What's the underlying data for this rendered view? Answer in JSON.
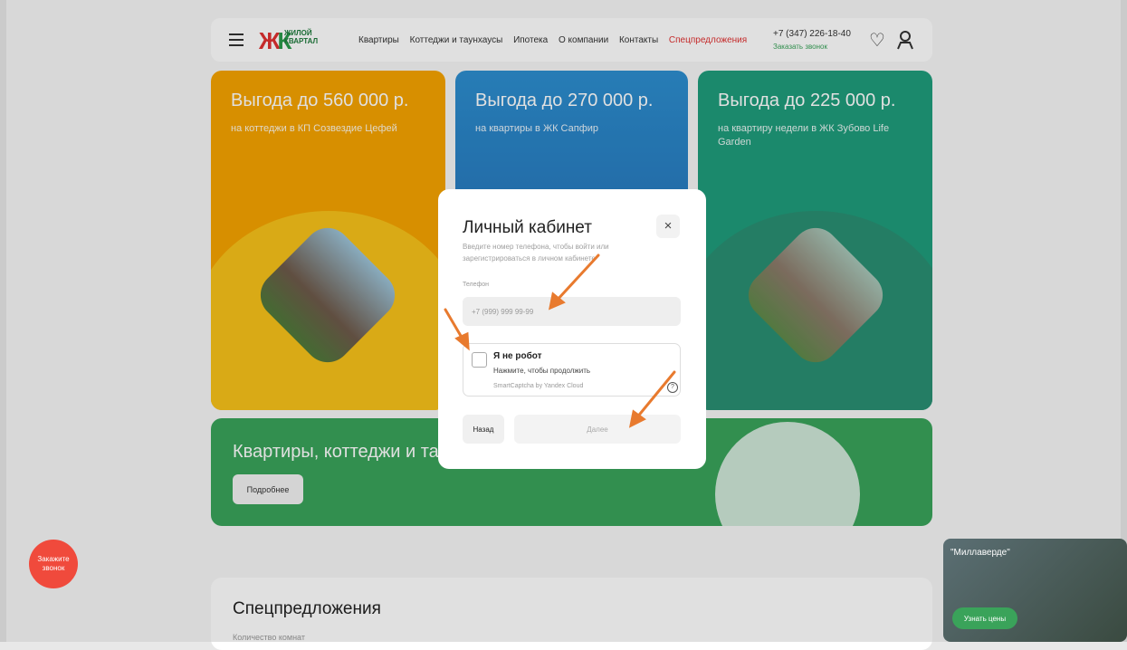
{
  "header": {
    "logo_title": "ЖИЛОЙ",
    "logo_subtitle": "КВАРТАЛ",
    "nav": [
      "Квартиры",
      "Коттеджи и таунхаусы",
      "Ипотека",
      "О компании",
      "Контакты",
      "Спецпредложения"
    ],
    "phone": "+7 (347) 226-18-40",
    "callback": "Заказать звонок"
  },
  "cards": [
    {
      "title": "Выгода до 560 000 р.",
      "subtitle": "на коттеджи в КП Созвездие Цефей"
    },
    {
      "title": "Выгода до 270 000 р.",
      "subtitle": "на квартиры в ЖК Сапфир"
    },
    {
      "title": "Выгода до 225 000 р.",
      "subtitle": "на квартиру недели в ЖК Зубово Life Garden"
    }
  ],
  "banner": {
    "title": "Квартиры, коттеджи и та",
    "button": "Подробнее"
  },
  "specials": {
    "title": "Спецпредложения",
    "subtitle": "Количество комнат"
  },
  "modal": {
    "title": "Личный кабинет",
    "close": "×",
    "subtitle": "Введите номер телефона, чтобы войти или зарегистрироваться в личном кабинете",
    "phone_label": "Телефон",
    "phone_placeholder": "+7 (999) 999 99-99",
    "captcha_title": "Я не робот",
    "captcha_hint": "Нажмите, чтобы продолжить",
    "captcha_brand": "SmartCaptcha by Yandex Cloud",
    "captcha_help": "?",
    "back": "Назад",
    "next": "Далее"
  },
  "order_call": "Закажите звонок",
  "widget": {
    "title": "\"Миллаверде\"",
    "button": "Узнать цены"
  },
  "colors": {
    "accent_red": "#e03030",
    "accent_green": "#3aa35a",
    "annotation_arrow": "#e87a2e"
  }
}
